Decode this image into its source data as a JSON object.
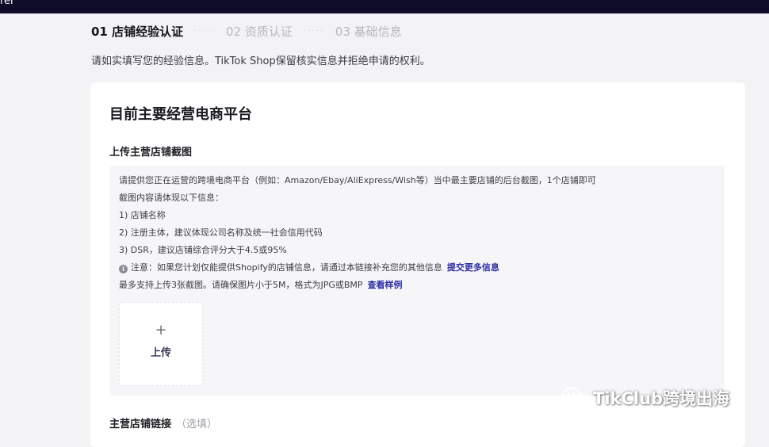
{
  "topbar": {
    "partial_text": "rer"
  },
  "steps": [
    {
      "label": "01 店铺经验认证",
      "state": "active"
    },
    {
      "label": "02 资质认证",
      "state": "inactive"
    },
    {
      "label": "03 基础信息",
      "state": "inactive"
    }
  ],
  "step_separator": "·····",
  "intro": "请如实填写您的经验信息。TikTok Shop保留核实信息并拒绝申请的权利。",
  "card": {
    "title": "目前主要经营电商平台",
    "section_title": "上传主营店铺截图",
    "instructions": [
      "请提供您正在运营的跨境电商平台（例如：Amazon/Ebay/AliExpress/Wish等）当中最主要店铺的后台截图，1个店铺即可",
      "截图内容请体现以下信息：",
      "1) 店铺名称",
      "2) 注册主体，建议体现公司名称及统一社会信用代码",
      "3) DSR，建议店铺综合评分大于4.5或95%"
    ],
    "note": {
      "icon": "info-icon",
      "text": "注意：如果您计划仅能提供Shopify的店铺信息，请通过本链接补充您的其他信息",
      "link": "提交更多信息"
    },
    "upload_hint": {
      "text": "最多支持上传3张截图。请确保图片小于5M，格式为JPG或BMP",
      "link": "查看样例"
    },
    "upload": {
      "icon": "plus-icon",
      "plus": "+",
      "label": "上传"
    },
    "link_section": {
      "title": "主营店铺链接",
      "optional": "（选填）"
    }
  },
  "watermark": {
    "icon": "wechat-icon",
    "text": "TikClub跨境出海"
  },
  "colors": {
    "topbar": "#0f0c2a",
    "link": "#2c2ca6",
    "page_bg": "#f3f3f6",
    "card_bg": "#ffffff",
    "info_bg": "#f6f6f8"
  }
}
